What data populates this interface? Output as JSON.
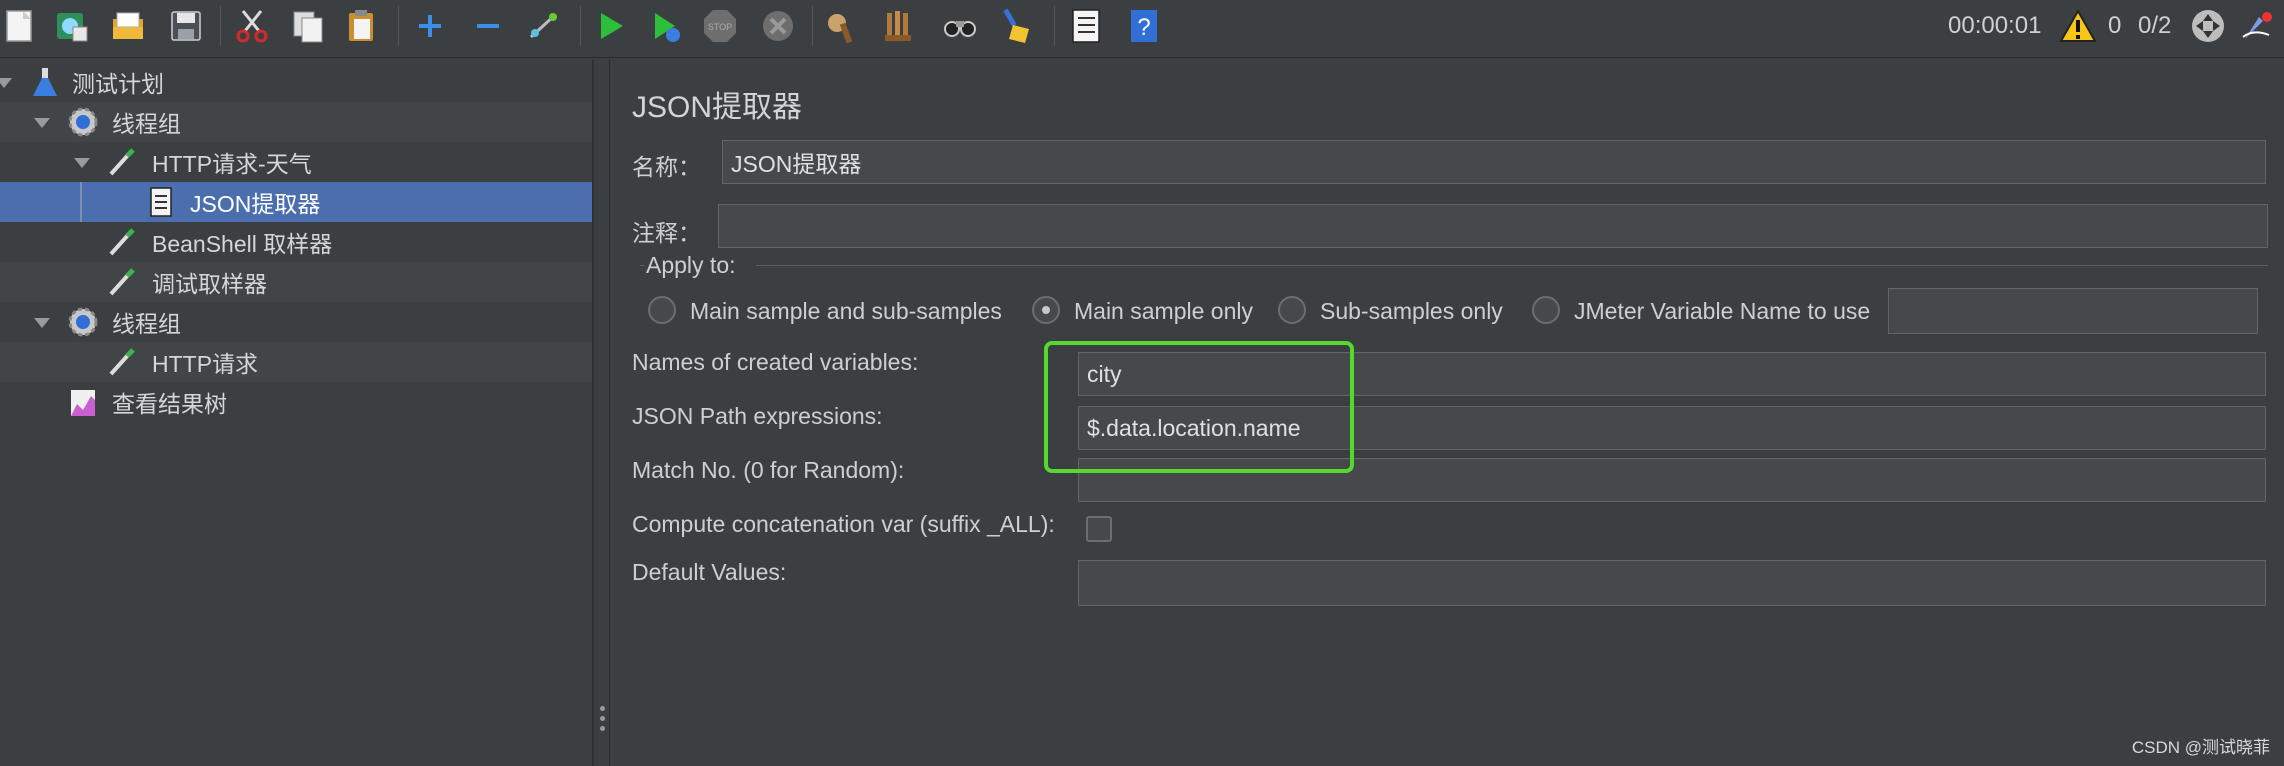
{
  "toolbar": {
    "icons": [
      "new-file-icon",
      "templates-icon",
      "open-icon",
      "save-icon",
      "cut-icon",
      "copy-icon",
      "paste-icon",
      "expand-icon",
      "collapse-icon",
      "toggle-icon",
      "start-icon",
      "start-no-pauses-icon",
      "stop-icon",
      "shutdown-icon",
      "clear-icon",
      "clear-all-icon",
      "search-icon",
      "reset-search-icon",
      "function-helper-icon",
      "help-icon"
    ],
    "elapsed_time": "00:00:01",
    "warning_count": "0",
    "active_threads": "0/2"
  },
  "tree": {
    "items": [
      {
        "label": "测试计划",
        "icon": "flask-icon"
      },
      {
        "label": "线程组",
        "icon": "gear-icon"
      },
      {
        "label": "HTTP请求-天气",
        "icon": "pipette-icon"
      },
      {
        "label": "JSON提取器",
        "icon": "document-icon",
        "selected": true
      },
      {
        "label": "BeanShell 取样器",
        "icon": "pipette-icon"
      },
      {
        "label": "调试取样器",
        "icon": "pipette-icon"
      },
      {
        "label": "线程组",
        "icon": "gear-icon"
      },
      {
        "label": "HTTP请求",
        "icon": "pipette-icon"
      },
      {
        "label": "查看结果树",
        "icon": "chart-icon"
      }
    ]
  },
  "panel": {
    "title": "JSON提取器",
    "name_label": "名称：",
    "name_value": "JSON提取器",
    "comment_label": "注释：",
    "comment_value": "",
    "apply_to": {
      "legend": "Apply to:",
      "options": [
        "Main sample and sub-samples",
        "Main sample only",
        "Sub-samples only",
        "JMeter Variable Name to use"
      ],
      "selected": "Main sample only",
      "variable_name_value": ""
    },
    "names_label": "Names of created variables:",
    "names_value": "city",
    "json_path_label": "JSON Path expressions:",
    "json_path_value": "$.data.location.name",
    "match_no_label": "Match No. (0 for Random):",
    "match_no_value": "",
    "concat_label": "Compute concatenation var (suffix _ALL):",
    "concat_checked": false,
    "default_label": "Default Values:",
    "default_value": "",
    "highlight_color": "#57d82e"
  },
  "watermark": "CSDN @测试晓菲"
}
